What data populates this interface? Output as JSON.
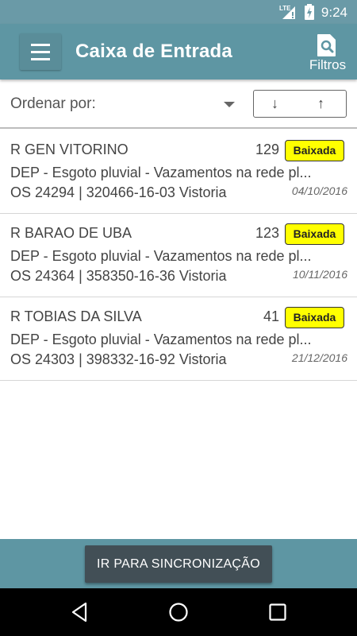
{
  "status_bar": {
    "time": "9:24",
    "network_label": "LTE"
  },
  "app_bar": {
    "title": "Caixa de Entrada",
    "filter_label": "Filtros",
    "menu_icon": "hamburger-menu-icon",
    "filter_icon": "search-document-icon"
  },
  "sort": {
    "label": "Ordenar por:",
    "desc_arrow": "↓",
    "asc_arrow": "↑"
  },
  "items": [
    {
      "street": "R GEN VITORINO",
      "number": "129",
      "badge": "Baixada",
      "description": "DEP - Esgoto pluvial - Vazamentos na rede pl...",
      "os_line": "OS 24294 | 320466-16-03   Vistoria",
      "date": "04/10/2016"
    },
    {
      "street": "R BARAO DE UBA",
      "number": "123",
      "badge": "Baixada",
      "description": "DEP - Esgoto pluvial - Vazamentos na rede pl...",
      "os_line": "OS 24364 | 358350-16-36   Vistoria",
      "date": "10/11/2016"
    },
    {
      "street": "R TOBIAS DA SILVA",
      "number": "41",
      "badge": "Baixada",
      "description": "DEP - Esgoto pluvial - Vazamentos na rede pl...",
      "os_line": "OS 24303 | 398332-16-92   Vistoria",
      "date": "21/12/2016"
    }
  ],
  "bottom": {
    "sync_label": "IR PARA SINCRONIZAÇÃO"
  },
  "colors": {
    "app_bar": "#5e96a3",
    "status_bar": "#6a9aa7",
    "badge": "#ffff00",
    "sync_button": "#424f56"
  }
}
